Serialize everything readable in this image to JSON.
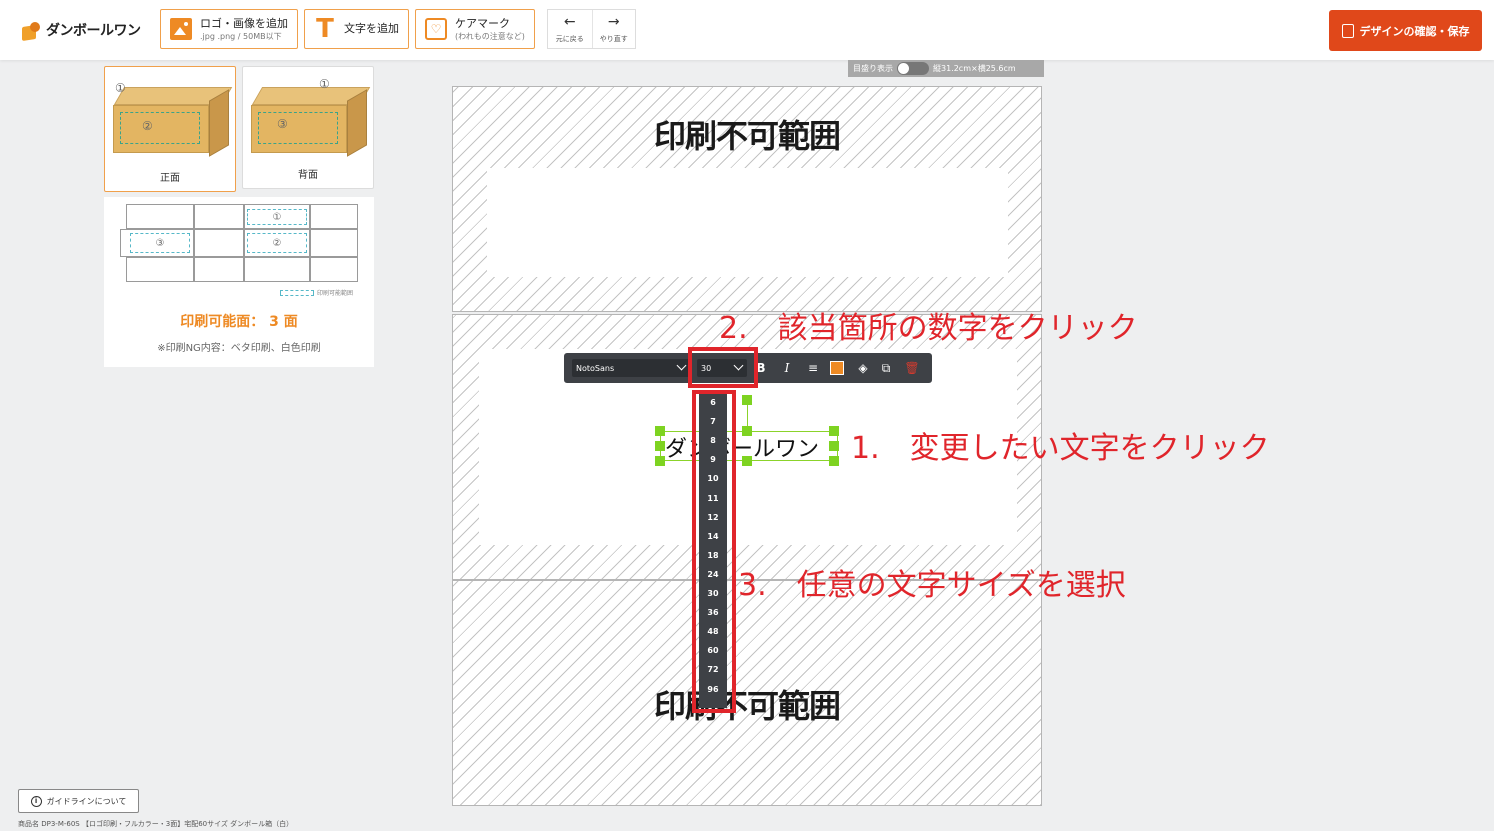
{
  "header": {
    "logo_text": "ダンボールワン",
    "add_logo": {
      "label": "ロゴ・画像を追加",
      "sub": ".jpg .png / 50MB以下"
    },
    "add_text": {
      "label": "文字を追加"
    },
    "care_mark": {
      "label": "ケアマーク",
      "sub": "(われもの注意など)"
    },
    "undo_label": "元に戻る",
    "redo_label": "やり直す",
    "save_label": "デザインの確認・保存"
  },
  "faces": [
    {
      "label": "正面",
      "num_top": "①",
      "num_center": "②",
      "active": true
    },
    {
      "label": "背面",
      "num_top": "①",
      "num_center": "③",
      "active": false
    }
  ],
  "net": {
    "cell1": "①",
    "cell2": "②",
    "cell3": "③",
    "legend": "印刷可能範囲",
    "title": "印刷可能面： 3 面",
    "note": "※印刷NG内容：ベタ印刷、白色印刷"
  },
  "canvas": {
    "ruler_label": "目盛り表示",
    "dimensions": "縦31.2cm×横25.6cm",
    "no_print_label": "印刷不可範囲",
    "selected_text": "ダンボールワン"
  },
  "toolbar": {
    "font": "NotoSans",
    "size": "30",
    "bold": "B",
    "italic": "I",
    "color": "#ee8a24"
  },
  "size_options": [
    "6",
    "7",
    "8",
    "9",
    "10",
    "11",
    "12",
    "14",
    "18",
    "24",
    "30",
    "36",
    "48",
    "60",
    "72",
    "96"
  ],
  "annotations": {
    "step1": "1.　変更したい文字をクリック",
    "step2": "2.　該当箇所の数字をクリック",
    "step3": "3.　任意の文字サイズを選択"
  },
  "footer": {
    "guide_label": "ガイドラインについて",
    "product_name": "商品名 DP3-M-60S 【ロゴ印刷・フルカラー・3面】宅配60サイズ ダンボール箱（白）"
  },
  "colors": {
    "accent": "#ee8a24",
    "save": "#e0481a",
    "annotation_red": "#e0252b",
    "selection_green": "#7ed321"
  }
}
